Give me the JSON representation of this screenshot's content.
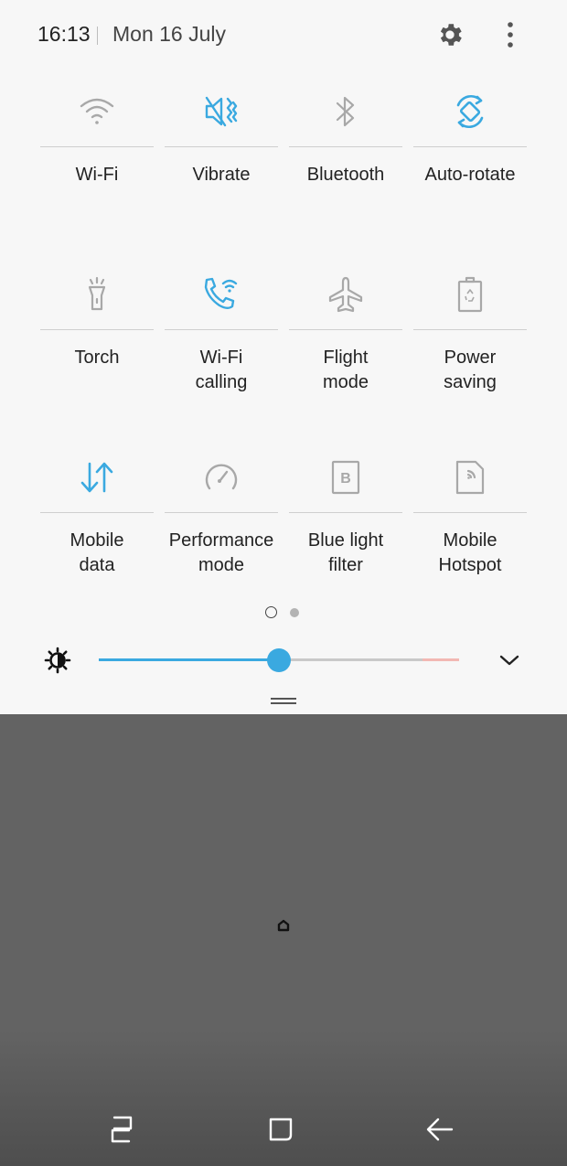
{
  "status": {
    "time": "16:13",
    "date": "Mon 16 July"
  },
  "tiles": [
    {
      "label": "Wi-Fi",
      "icon": "wifi-icon",
      "active": false
    },
    {
      "label": "Vibrate",
      "icon": "vibrate-icon",
      "active": true
    },
    {
      "label": "Bluetooth",
      "icon": "bluetooth-icon",
      "active": false
    },
    {
      "label": "Auto-rotate",
      "icon": "auto-rotate-icon",
      "active": true
    },
    {
      "label": "Torch",
      "icon": "torch-icon",
      "active": false
    },
    {
      "label": "Wi-Fi\ncalling",
      "icon": "wifi-calling-icon",
      "active": true
    },
    {
      "label": "Flight\nmode",
      "icon": "airplane-icon",
      "active": false
    },
    {
      "label": "Power\nsaving",
      "icon": "power-saving-icon",
      "active": false
    },
    {
      "label": "Mobile\ndata",
      "icon": "mobile-data-icon",
      "active": true
    },
    {
      "label": "Performance\nmode",
      "icon": "performance-icon",
      "active": false
    },
    {
      "label": "Blue light\nfilter",
      "icon": "blue-light-filter-icon",
      "active": false
    },
    {
      "label": "Mobile\nHotspot",
      "icon": "hotspot-icon",
      "active": false
    }
  ],
  "pager": {
    "current": 1,
    "total": 2
  },
  "brightness": {
    "level": 0.5
  },
  "colors": {
    "active": "#3aa9e0",
    "inactive": "#a8a8a8",
    "panel": "#f7f7f7",
    "background": "#636363"
  }
}
